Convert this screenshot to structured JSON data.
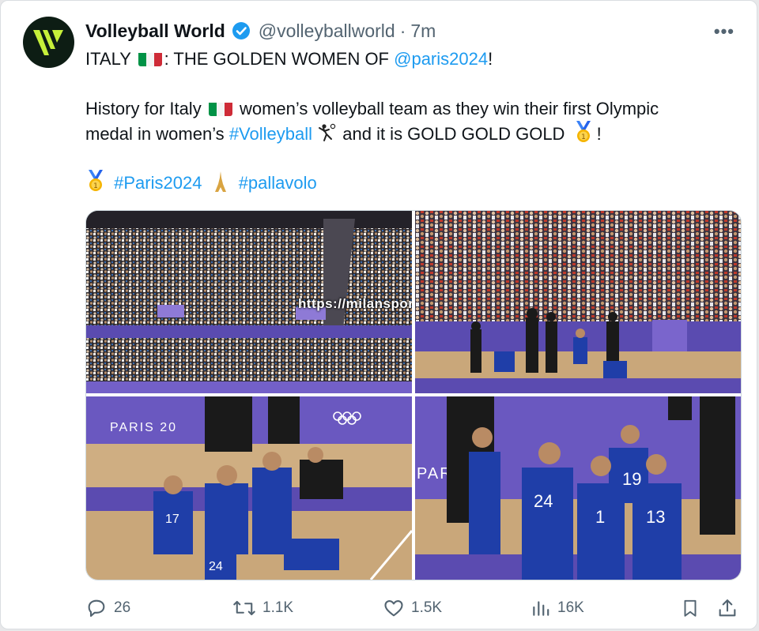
{
  "tweet": {
    "author_name": "Volleyball World",
    "handle": "@volleyballworld",
    "separator": "·",
    "time": "7m",
    "more": "•••",
    "line1_prefix": "ITALY",
    "line1_middle": ": THE GOLDEN WOMEN OF",
    "line1_mention": "@paris2024",
    "line1_suffix": "!",
    "para2_a": "History for Italy",
    "para2_b": "women’s volleyball team as they win their first Olympic",
    "para2_c": "medal in women’s",
    "para2_hashtag": "#Volleyball",
    "para2_d": "and it is GOLD GOLD GOLD",
    "para2_e": "!",
    "hashtag_paris": "#Paris2024",
    "hashtag_pallavolo": "#pallavolo"
  },
  "media": {
    "watermark": "https://milansportsd.com/",
    "banner_text_1": "PARIS 20",
    "banner_text_2": "PAR",
    "jersey_numbers": [
      "17",
      "24",
      "24",
      "19",
      "1",
      "13"
    ]
  },
  "actions": {
    "replies": "26",
    "reposts": "1.1K",
    "likes": "1.5K",
    "views": "16K"
  },
  "colors": {
    "accent": "#1d9bf0",
    "muted": "#536471",
    "italy_green": "#009246",
    "italy_white": "#ffffff",
    "italy_red": "#ce2b37",
    "team_blue": "#1f3ea8",
    "court_tan": "#c9a77a",
    "court_purple": "#5b4bb0"
  }
}
